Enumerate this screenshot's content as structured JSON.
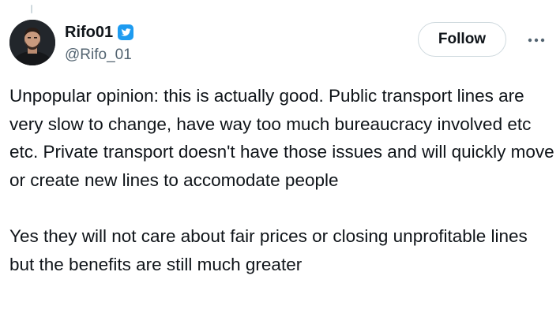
{
  "author": {
    "display_name": "Rifo01",
    "handle": "@Rifo_01",
    "verified": true,
    "avatar_icon": "profile-photo-avatar"
  },
  "actions": {
    "follow_label": "Follow",
    "more_icon": "ellipsis-icon"
  },
  "tweet": {
    "paragraphs": [
      "Unpopular opinion: this is actually good. Public transport lines are very slow to change, have way too much bureaucracy involved etc etc. Private transport doesn't have those issues and will quickly move or create new lines to accomodate people",
      "Yes they will not care about fair prices or closing unprofitable lines but the benefits are still much greater"
    ]
  },
  "colors": {
    "text": "#0f1419",
    "secondary_text": "#536471",
    "verified_blue": "#1d9bf0",
    "border": "#cfd9de",
    "background": "#ffffff"
  }
}
